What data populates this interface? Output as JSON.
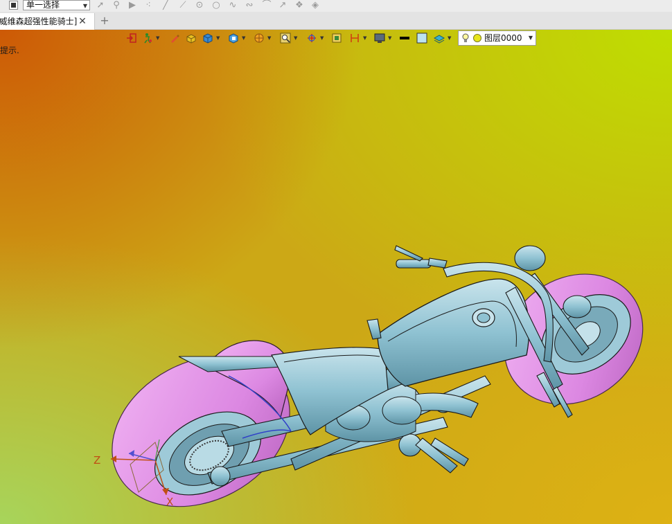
{
  "top_toolbar": {
    "selection_mode": "单一选择",
    "snap_tools": [
      "select-arrow-icon",
      "filter-icon",
      "play-icon",
      "scatter-points-icon",
      "line-icon",
      "line-endpoint-icon",
      "circle-center-icon",
      "circle-icon",
      "curve-icon",
      "wave-icon",
      "arc-icon",
      "arrow-line-icon",
      "stack-icon",
      "layers-icon"
    ]
  },
  "tabs": {
    "active_tab": "[威维森超强性能骑士]",
    "new_tab_symbol": "+",
    "close_symbol": "✕"
  },
  "viewport": {
    "hint": "提示.",
    "layer_name": "图层0000",
    "axes": {
      "z": "Z",
      "x": "X"
    }
  },
  "view_toolbar": {
    "icons": [
      "exit-view-icon",
      "person-walk-icon",
      "pencil-icon",
      "shaded-box-icon",
      "solid-cube-icon",
      "section-cube-icon",
      "render-sphere-icon",
      "zoom-window-icon",
      "rotate-axis-icon",
      "view-frame-icon",
      "dimension-icon",
      "display-monitor-icon",
      "line-color-icon",
      "fill-color-icon",
      "layer-manager-icon"
    ]
  },
  "colors": {
    "bg_top_left": "#cd5505",
    "bg_top_right": "#bee100",
    "bg_bottom_left": "#a5d75f",
    "bg_bottom_right": "#deb214",
    "model_body": "#8fc2d2",
    "model_tyres": "#dc88e2",
    "model_lines": "#1a1a1a",
    "axis_label": "#c04e14"
  }
}
